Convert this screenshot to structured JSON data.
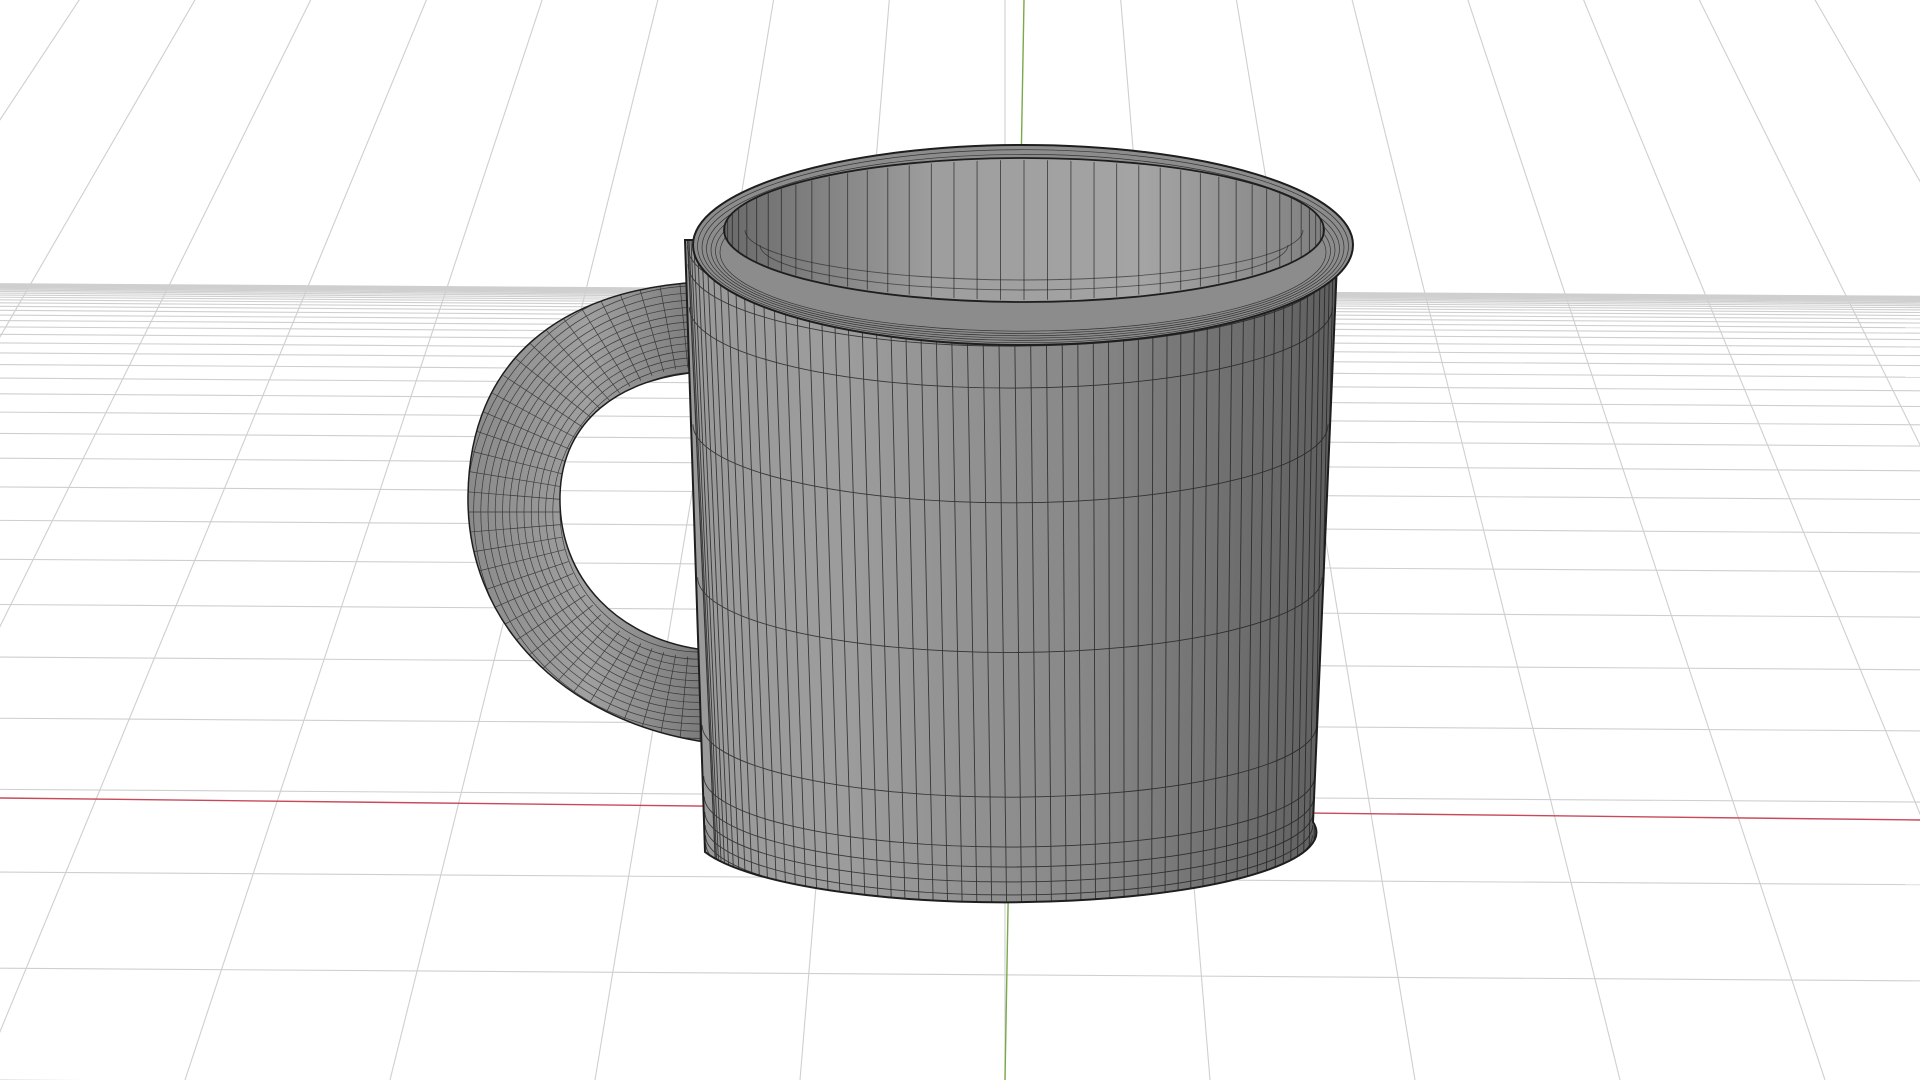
{
  "viewport": {
    "background": "#ffffff",
    "grid_color": "#cfcfcf",
    "x_axis_color": "#c84a5a",
    "y_axis_color": "#7aa84a",
    "wire_color": "#1e1e1e"
  },
  "object": {
    "type": "mug",
    "shading": "solid-with-wireframe",
    "base_color": "#8c8c8c"
  }
}
